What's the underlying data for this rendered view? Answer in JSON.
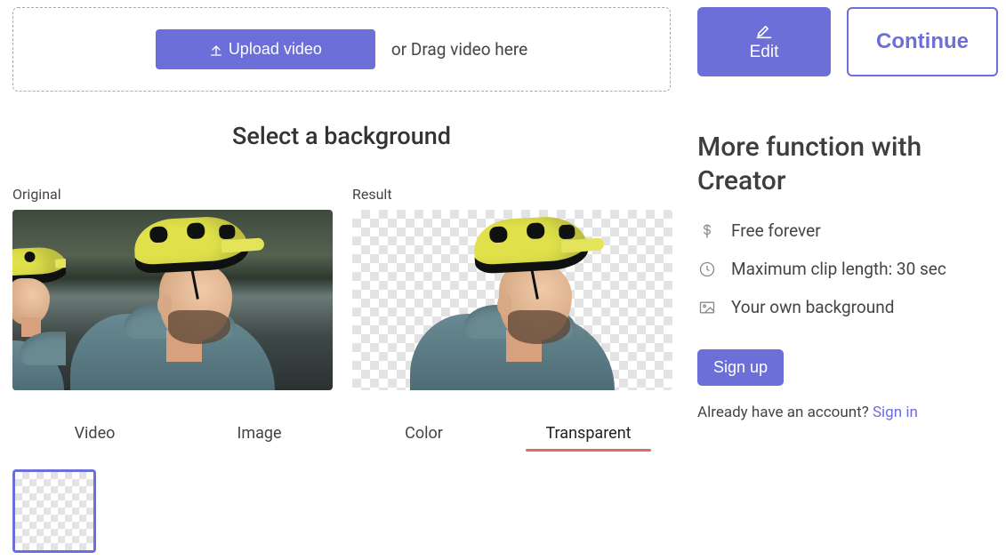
{
  "upload": {
    "button": "Upload video",
    "drag": "or Drag video here"
  },
  "actions": {
    "edit": "Edit",
    "continue": "Continue"
  },
  "select_bg_title": "Select a background",
  "preview": {
    "original": "Original",
    "result": "Result"
  },
  "tabs": [
    "Video",
    "Image",
    "Color",
    "Transparent"
  ],
  "active_tab": "Transparent",
  "sidebar": {
    "title": "More function with Creator",
    "features": [
      "Free forever",
      "Maximum clip length: 30 sec",
      "Your own background"
    ],
    "signup": "Sign up",
    "already": "Already have an account? ",
    "signin": "Sign in"
  }
}
